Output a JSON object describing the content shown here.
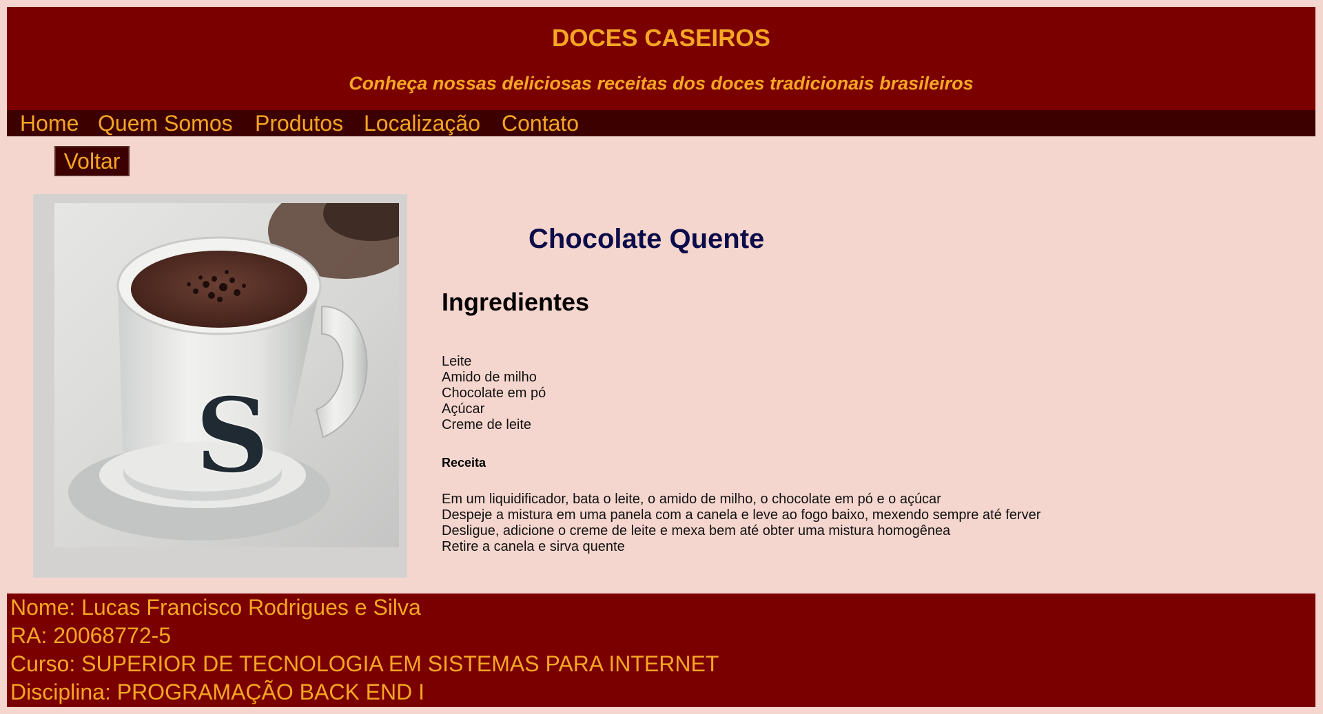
{
  "header": {
    "title": "DOCES CASEIROS",
    "tagline": "Conheça nossas deliciosas receitas dos doces tradicionais brasileiros"
  },
  "nav": {
    "items": [
      {
        "label": "Home"
      },
      {
        "label": "Quem Somos"
      },
      {
        "label": "Produtos"
      },
      {
        "label": "Localização"
      },
      {
        "label": "Contato"
      }
    ]
  },
  "back_button": {
    "label": "Voltar"
  },
  "recipe": {
    "title": "Chocolate Quente",
    "ingredients_heading": "Ingredientes",
    "ingredients": [
      "Leite",
      "Amido de milho",
      "Chocolate em pó",
      "Açúcar",
      "Creme de leite"
    ],
    "steps_heading": "Receita",
    "steps": [
      "Em um liquidificador, bata o leite, o amido de milho, o chocolate em pó e o açúcar",
      "Despeje a mistura em uma panela com a canela e leve ao fogo baixo, mexendo sempre até ferver",
      "Desligue, adicione o creme de leite e mexa bem até obter uma mistura homogênea",
      "Retire a canela e sirva quente"
    ]
  },
  "footer": {
    "name": "Nome: Lucas Francisco Rodrigues e Silva",
    "ra": "RA: 20068772-5",
    "course": "Curso: SUPERIOR DE TECNOLOGIA EM SISTEMAS PARA INTERNET",
    "discipline": "Disciplina: PROGRAMAÇÃO BACK END I"
  },
  "colors": {
    "page_background": "#f5d6ce",
    "header_background": "#7a0000",
    "nav_background": "#3d0000",
    "accent_text": "#f5a623",
    "recipe_title": "#0c0c4a",
    "image_frame": "#d3d2d1"
  }
}
